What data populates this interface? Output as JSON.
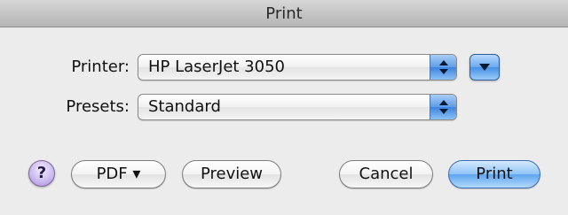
{
  "window": {
    "title": "Print"
  },
  "printer": {
    "label": "Printer:",
    "selected": "HP LaserJet 3050"
  },
  "presets": {
    "label": "Presets:",
    "selected": "Standard"
  },
  "buttons": {
    "help": "?",
    "pdf": "PDF ▾",
    "preview": "Preview",
    "cancel": "Cancel",
    "print": "Print"
  },
  "icons": {
    "popup_arrows": "up-down-arrows-icon",
    "disclosure": "disclosure-triangle-icon",
    "help": "help-icon"
  },
  "colors": {
    "accent_blue": "#5ea4ef",
    "help_purple": "#c9b6ee"
  }
}
